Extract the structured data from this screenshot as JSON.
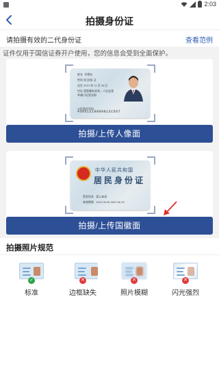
{
  "status": {
    "time": "2:03"
  },
  "nav": {
    "title": "拍摄身份证"
  },
  "hint": {
    "text": "请拍摄有效的二代身份证",
    "sample_link": "查看范例"
  },
  "privacy": "证件仅用于国信证券开户使用，您的信息会受到全面保护。",
  "front_card": {
    "name_label": "姓名",
    "name": "代得名",
    "line2": "性别 男 民族 汉",
    "line3": "出生 2013 年 11 月 26 日",
    "line4": "住址 国家最有关系，人在这里",
    "line5": "幸福小区阳光街",
    "id_number_label": "公民身份号码",
    "id_number": "430512198908131567"
  },
  "back_card": {
    "country": "中华人民共和国",
    "title": "居民身份证",
    "row1_label": "签发机关",
    "row1_value": "某公安局",
    "row2_label": "有效期限",
    "row2_value": "2012.06.25-2022.06.25"
  },
  "buttons": {
    "front": "拍摄/上传人像面",
    "back": "拍摄/上传国徽面"
  },
  "rules": {
    "title": "拍摄照片规范",
    "items": [
      {
        "label": "标准",
        "status": "ok"
      },
      {
        "label": "边框缺失",
        "status": "error"
      },
      {
        "label": "照片模糊",
        "status": "error"
      },
      {
        "label": "闪光强烈",
        "status": "error"
      }
    ]
  },
  "colors": {
    "primary": "#2d4f96",
    "link": "#2f5fb0",
    "ok": "#2ca44a",
    "error": "#e03a3a",
    "arrow": "#e0302b"
  }
}
